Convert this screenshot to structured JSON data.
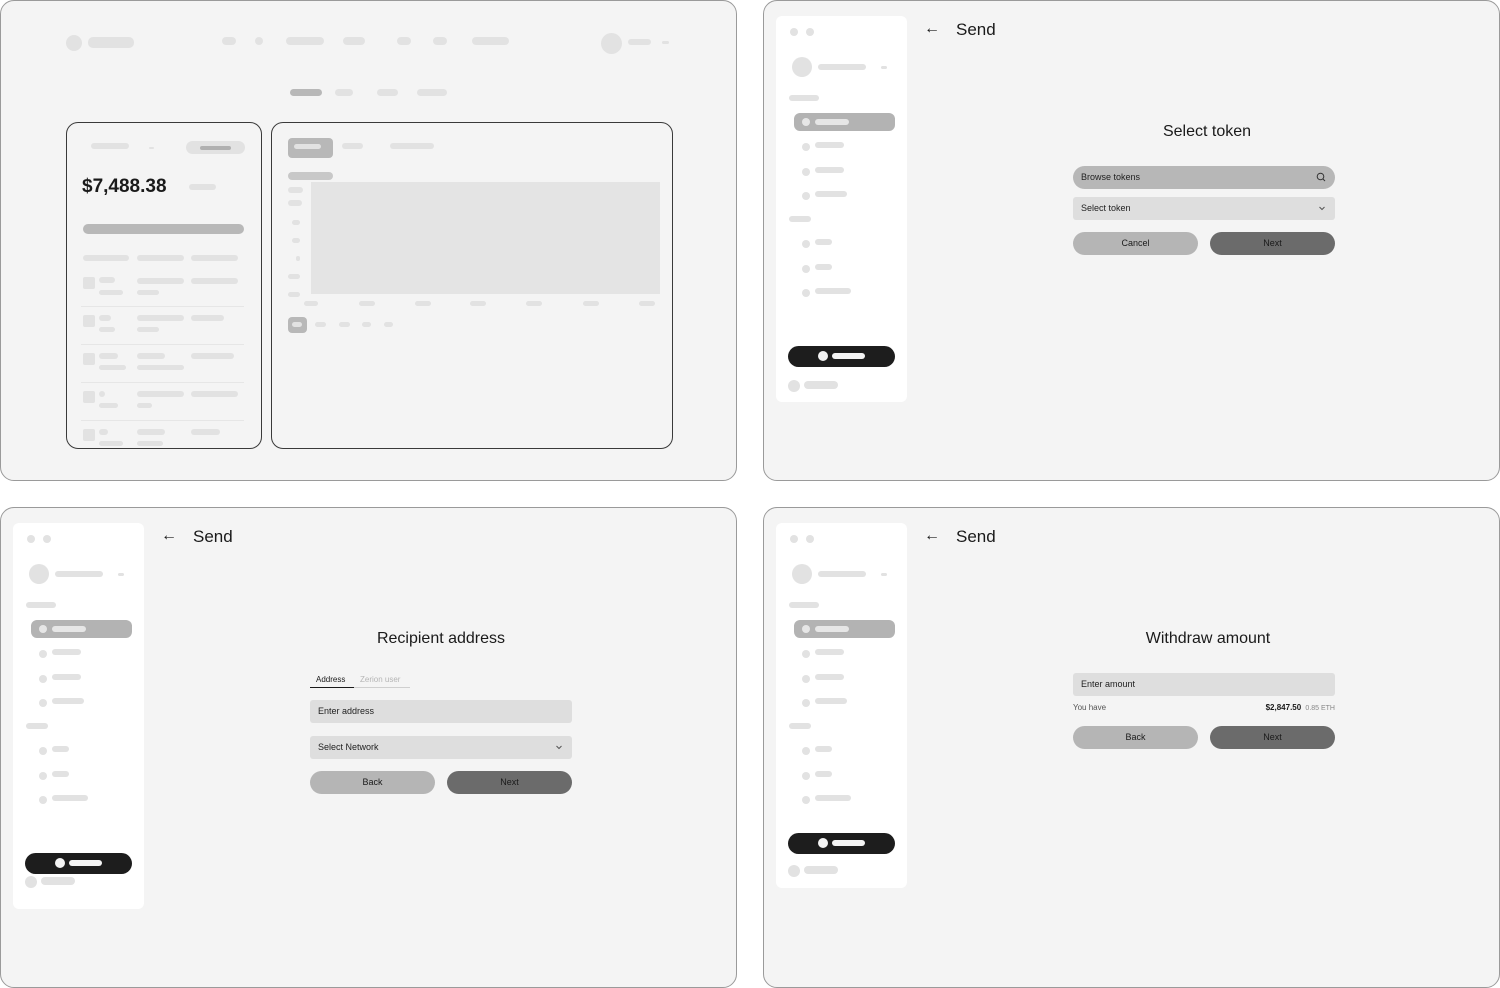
{
  "dashboard": {
    "balance": "$7,488.38"
  },
  "send_header": {
    "back_icon": "←",
    "title": "Send"
  },
  "select_token": {
    "title": "Select token",
    "search_placeholder": "Browse tokens",
    "select_placeholder": "Select token",
    "cancel_label": "Cancel",
    "next_label": "Next"
  },
  "recipient": {
    "title": "Recipient address",
    "tabs": [
      "Address",
      "Zerion user"
    ],
    "address_placeholder": "Enter address",
    "network_placeholder": "Select Network",
    "back_label": "Back",
    "next_label": "Next"
  },
  "withdraw": {
    "title": "Withdraw amount",
    "amount_placeholder": "Enter amount",
    "you_have_label": "You have",
    "available_usd": "$2,847.50",
    "available_token": "0.85 ETH",
    "back_label": "Back",
    "next_label": "Next"
  },
  "icons": {
    "search": "search-icon",
    "chevron": "chevron-down-icon",
    "back": "arrow-left-icon"
  },
  "colors": {
    "panel_bg": "#f4f4f4",
    "primary_button": "#6b6b6b",
    "secondary_button": "#b5b5b5",
    "wallet_button": "#1d1d1d"
  }
}
